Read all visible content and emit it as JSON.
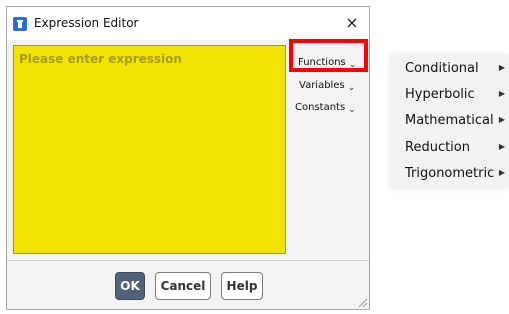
{
  "dialog": {
    "title": "Expression Editor",
    "close_glyph": "×",
    "app_icon": "app-icon",
    "expression": {
      "value": "",
      "placeholder": "Please enter expression"
    },
    "menus": [
      {
        "label": "Functions",
        "caret": "⌄"
      },
      {
        "label": "Variables",
        "caret": "⌄"
      },
      {
        "label": "Constants",
        "caret": "⌄"
      }
    ],
    "buttons": {
      "ok": "OK",
      "cancel": "Cancel",
      "help": "Help"
    }
  },
  "functions_submenu": {
    "items": [
      {
        "label": "Conditional",
        "arrow": "▶"
      },
      {
        "label": "Hyperbolic",
        "arrow": "▶"
      },
      {
        "label": "Mathematical",
        "arrow": "▶"
      },
      {
        "label": "Reduction",
        "arrow": "▶"
      },
      {
        "label": "Trigonometric",
        "arrow": "▶"
      }
    ]
  },
  "colors": {
    "expression_background": "#f0e400",
    "highlight_box": "#ff0000",
    "ok_button": "#52627a"
  }
}
